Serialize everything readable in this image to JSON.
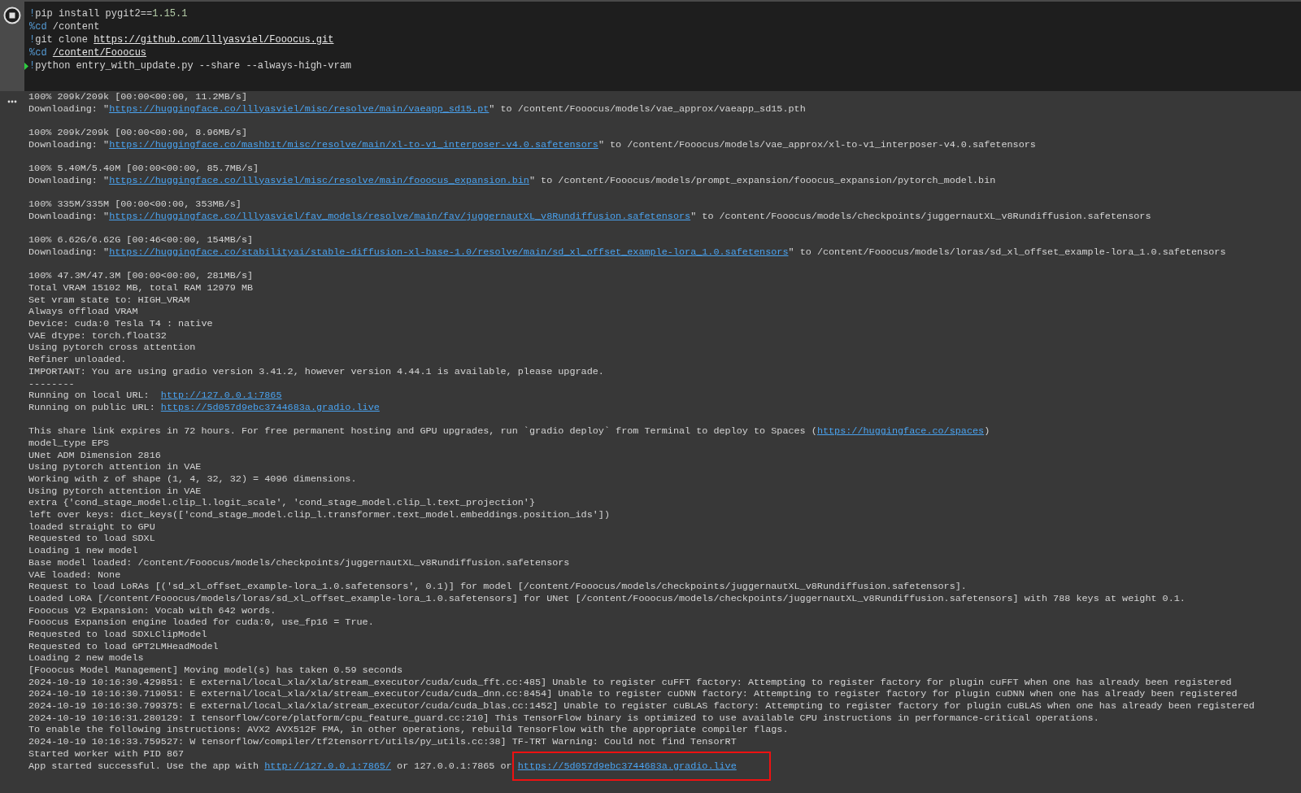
{
  "code_cell": {
    "lines": [
      {
        "executing": false,
        "segments": [
          {
            "kind": "magic",
            "text": "!"
          },
          {
            "kind": "plain",
            "text": "pip install pygit2=="
          },
          {
            "kind": "number",
            "text": "1.15.1"
          }
        ]
      },
      {
        "executing": false,
        "segments": [
          {
            "kind": "magic",
            "text": "%cd"
          },
          {
            "kind": "plain",
            "text": " /content"
          }
        ]
      },
      {
        "executing": false,
        "segments": [
          {
            "kind": "magic",
            "text": "!"
          },
          {
            "kind": "plain",
            "text": "git clone "
          },
          {
            "kind": "link",
            "text": "https://github.com/lllyasviel/Fooocus.git"
          }
        ]
      },
      {
        "executing": false,
        "segments": [
          {
            "kind": "magic",
            "text": "%cd "
          },
          {
            "kind": "link",
            "text": "/content/Fooocus"
          }
        ]
      },
      {
        "executing": true,
        "segments": [
          {
            "kind": "magic",
            "text": "!"
          },
          {
            "kind": "plain",
            "text": "python entry_with_update.py --share --always-high-vram"
          }
        ]
      }
    ]
  },
  "output": {
    "blocks": [
      [
        [
          {
            "kind": "text",
            "text": "100% 209k/209k [00:00<00:00, 11.2MB/s]"
          }
        ],
        [
          {
            "kind": "text",
            "text": "Downloading: \""
          },
          {
            "kind": "link",
            "text": "https://huggingface.co/lllyasviel/misc/resolve/main/vaeapp_sd15.pt",
            "highlighted": false
          },
          {
            "kind": "text",
            "text": "\" to /content/Fooocus/models/vae_approx/vaeapp_sd15.pth"
          }
        ]
      ],
      [
        [
          {
            "kind": "text",
            "text": "100% 209k/209k [00:00<00:00, 8.96MB/s]"
          }
        ],
        [
          {
            "kind": "text",
            "text": "Downloading: \""
          },
          {
            "kind": "link",
            "text": "https://huggingface.co/mashb1t/misc/resolve/main/xl-to-v1_interposer-v4.0.safetensors",
            "highlighted": false
          },
          {
            "kind": "text",
            "text": "\" to /content/Fooocus/models/vae_approx/xl-to-v1_interposer-v4.0.safetensors"
          }
        ]
      ],
      [
        [
          {
            "kind": "text",
            "text": "100% 5.40M/5.40M [00:00<00:00, 85.7MB/s]"
          }
        ],
        [
          {
            "kind": "text",
            "text": "Downloading: \""
          },
          {
            "kind": "link",
            "text": "https://huggingface.co/lllyasviel/misc/resolve/main/fooocus_expansion.bin",
            "highlighted": false
          },
          {
            "kind": "text",
            "text": "\" to /content/Fooocus/models/prompt_expansion/fooocus_expansion/pytorch_model.bin"
          }
        ]
      ],
      [
        [
          {
            "kind": "text",
            "text": "100% 335M/335M [00:00<00:00, 353MB/s]"
          }
        ],
        [
          {
            "kind": "text",
            "text": "Downloading: \""
          },
          {
            "kind": "link",
            "text": "https://huggingface.co/lllyasviel/fav_models/resolve/main/fav/juggernautXL_v8Rundiffusion.safetensors",
            "highlighted": false
          },
          {
            "kind": "text",
            "text": "\" to /content/Fooocus/models/checkpoints/juggernautXL_v8Rundiffusion.safetensors"
          }
        ]
      ],
      [
        [
          {
            "kind": "text",
            "text": "100% 6.62G/6.62G [00:46<00:00, 154MB/s]"
          }
        ],
        [
          {
            "kind": "text",
            "text": "Downloading: \""
          },
          {
            "kind": "link",
            "text": "https://huggingface.co/stabilityai/stable-diffusion-xl-base-1.0/resolve/main/sd_xl_offset_example-lora_1.0.safetensors",
            "highlighted": false
          },
          {
            "kind": "text",
            "text": "\" to /content/Fooocus/models/loras/sd_xl_offset_example-lora_1.0.safetensors"
          }
        ]
      ],
      [
        [
          {
            "kind": "text",
            "text": "100% 47.3M/47.3M [00:00<00:00, 281MB/s]"
          }
        ],
        [
          {
            "kind": "text",
            "text": "Total VRAM 15102 MB, total RAM 12979 MB"
          }
        ],
        [
          {
            "kind": "text",
            "text": "Set vram state to: HIGH_VRAM"
          }
        ],
        [
          {
            "kind": "text",
            "text": "Always offload VRAM"
          }
        ],
        [
          {
            "kind": "text",
            "text": "Device: cuda:0 Tesla T4 : native"
          }
        ],
        [
          {
            "kind": "text",
            "text": "VAE dtype: torch.float32"
          }
        ],
        [
          {
            "kind": "text",
            "text": "Using pytorch cross attention"
          }
        ],
        [
          {
            "kind": "text",
            "text": "Refiner unloaded."
          }
        ],
        [
          {
            "kind": "text",
            "text": "IMPORTANT: You are using gradio version 3.41.2, however version 4.44.1 is available, please upgrade."
          }
        ],
        [
          {
            "kind": "text",
            "text": "--------"
          }
        ],
        [
          {
            "kind": "text",
            "text": "Running on local URL:  "
          },
          {
            "kind": "link",
            "text": "http://127.0.0.1:7865",
            "highlighted": false
          }
        ],
        [
          {
            "kind": "text",
            "text": "Running on public URL: "
          },
          {
            "kind": "link",
            "text": "https://5d057d9ebc3744683a.gradio.live",
            "highlighted": false
          }
        ]
      ],
      [
        [
          {
            "kind": "text",
            "text": "This share link expires in 72 hours. For free permanent hosting and GPU upgrades, run `gradio deploy` from Terminal to deploy to Spaces ("
          },
          {
            "kind": "link",
            "text": "https://huggingface.co/spaces",
            "highlighted": false
          },
          {
            "kind": "text",
            "text": ")"
          }
        ],
        [
          {
            "kind": "text",
            "text": "model_type EPS"
          }
        ],
        [
          {
            "kind": "text",
            "text": "UNet ADM Dimension 2816"
          }
        ],
        [
          {
            "kind": "text",
            "text": "Using pytorch attention in VAE"
          }
        ],
        [
          {
            "kind": "text",
            "text": "Working with z of shape (1, 4, 32, 32) = 4096 dimensions."
          }
        ],
        [
          {
            "kind": "text",
            "text": "Using pytorch attention in VAE"
          }
        ],
        [
          {
            "kind": "text",
            "text": "extra {'cond_stage_model.clip_l.logit_scale', 'cond_stage_model.clip_l.text_projection'}"
          }
        ],
        [
          {
            "kind": "text",
            "text": "left over keys: dict_keys(['cond_stage_model.clip_l.transformer.text_model.embeddings.position_ids'])"
          }
        ],
        [
          {
            "kind": "text",
            "text": "loaded straight to GPU"
          }
        ],
        [
          {
            "kind": "text",
            "text": "Requested to load SDXL"
          }
        ],
        [
          {
            "kind": "text",
            "text": "Loading 1 new model"
          }
        ],
        [
          {
            "kind": "text",
            "text": "Base model loaded: /content/Fooocus/models/checkpoints/juggernautXL_v8Rundiffusion.safetensors"
          }
        ],
        [
          {
            "kind": "text",
            "text": "VAE loaded: None"
          }
        ],
        [
          {
            "kind": "text",
            "text": "Request to load LoRAs [('sd_xl_offset_example-lora_1.0.safetensors', 0.1)] for model [/content/Fooocus/models/checkpoints/juggernautXL_v8Rundiffusion.safetensors]."
          }
        ],
        [
          {
            "kind": "text",
            "text": "Loaded LoRA [/content/Fooocus/models/loras/sd_xl_offset_example-lora_1.0.safetensors] for UNet [/content/Fooocus/models/checkpoints/juggernautXL_v8Rundiffusion.safetensors] with 788 keys at weight 0.1."
          }
        ],
        [
          {
            "kind": "text",
            "text": "Fooocus V2 Expansion: Vocab with 642 words."
          }
        ],
        [
          {
            "kind": "text",
            "text": "Fooocus Expansion engine loaded for cuda:0, use_fp16 = True."
          }
        ],
        [
          {
            "kind": "text",
            "text": "Requested to load SDXLClipModel"
          }
        ],
        [
          {
            "kind": "text",
            "text": "Requested to load GPT2LMHeadModel"
          }
        ],
        [
          {
            "kind": "text",
            "text": "Loading 2 new models"
          }
        ],
        [
          {
            "kind": "text",
            "text": "[Fooocus Model Management] Moving model(s) has taken 0.59 seconds"
          }
        ],
        [
          {
            "kind": "text",
            "text": "2024-10-19 10:16:30.429851: E external/local_xla/xla/stream_executor/cuda/cuda_fft.cc:485] Unable to register cuFFT factory: Attempting to register factory for plugin cuFFT when one has already been registered"
          }
        ],
        [
          {
            "kind": "text",
            "text": "2024-10-19 10:16:30.719051: E external/local_xla/xla/stream_executor/cuda/cuda_dnn.cc:8454] Unable to register cuDNN factory: Attempting to register factory for plugin cuDNN when one has already been registered"
          }
        ],
        [
          {
            "kind": "text",
            "text": "2024-10-19 10:16:30.799375: E external/local_xla/xla/stream_executor/cuda/cuda_blas.cc:1452] Unable to register cuBLAS factory: Attempting to register factory for plugin cuBLAS when one has already been registered"
          }
        ],
        [
          {
            "kind": "text",
            "text": "2024-10-19 10:16:31.280129: I tensorflow/core/platform/cpu_feature_guard.cc:210] This TensorFlow binary is optimized to use available CPU instructions in performance-critical operations."
          }
        ],
        [
          {
            "kind": "text",
            "text": "To enable the following instructions: AVX2 AVX512F FMA, in other operations, rebuild TensorFlow with the appropriate compiler flags."
          }
        ],
        [
          {
            "kind": "text",
            "text": "2024-10-19 10:16:33.759527: W tensorflow/compiler/tf2tensorrt/utils/py_utils.cc:38] TF-TRT Warning: Could not find TensorRT"
          }
        ],
        [
          {
            "kind": "text",
            "text": "Started worker with PID 867"
          }
        ],
        [
          {
            "kind": "text",
            "text": "App started successful. Use the app with "
          },
          {
            "kind": "link",
            "text": "http://127.0.0.1:7865/",
            "highlighted": false
          },
          {
            "kind": "text",
            "text": " or 127.0.0.1:7865 or "
          },
          {
            "kind": "link",
            "text": "https://5d057d9ebc3744683a.gradio.live",
            "highlighted": true
          }
        ]
      ]
    ]
  }
}
